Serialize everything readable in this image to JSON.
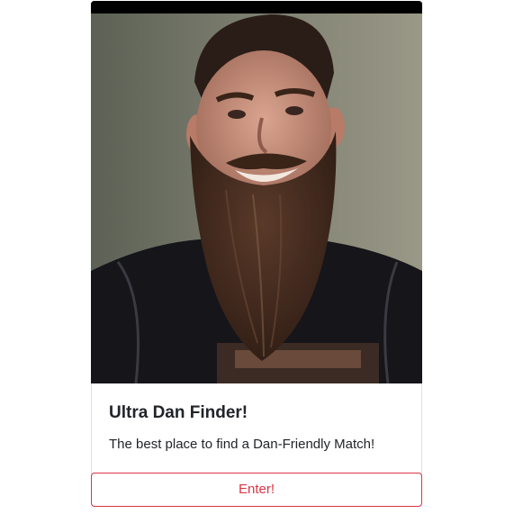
{
  "card": {
    "title": "Ultra Dan Finder!",
    "text": "The best place to find a Dan-Friendly Match!",
    "button_label": "Enter!"
  },
  "colors": {
    "accent": "#dc3545",
    "text": "#212529",
    "border": "rgba(0,0,0,0.125)"
  }
}
